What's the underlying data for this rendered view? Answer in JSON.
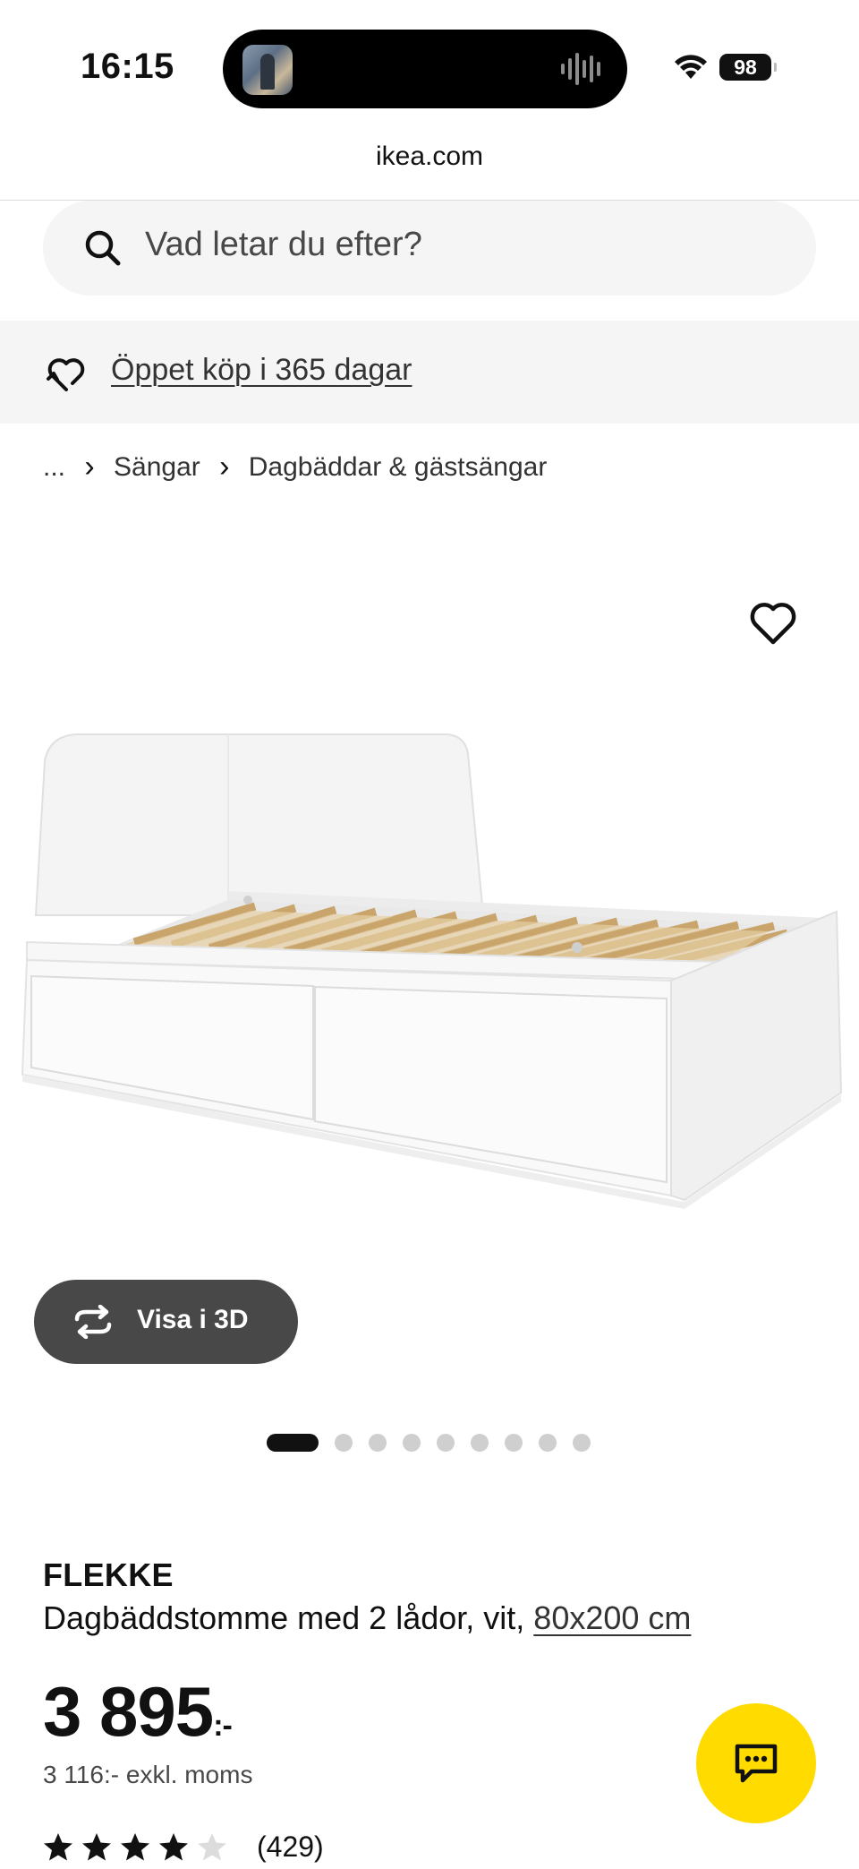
{
  "status_bar": {
    "time": "16:15",
    "battery": "98"
  },
  "browser": {
    "url": "ikea.com"
  },
  "search": {
    "placeholder": "Vad letar du efter?"
  },
  "promo": {
    "text": "Öppet köp i 365 dagar"
  },
  "breadcrumb": {
    "items": [
      "...",
      "Sängar",
      "Dagbäddar & gästsängar"
    ]
  },
  "hero": {
    "view_3d_label": "Visa i 3D",
    "carousel": {
      "total": 9,
      "active_index": 0
    }
  },
  "product": {
    "name": "FLEKKE",
    "description": "Dagbäddstomme med 2 lådor, vit,",
    "size": "80x200 cm",
    "price": "3 895",
    "price_suffix": ":-",
    "price_excl_vat": "3 116:- exkl. moms",
    "rating": {
      "stars": 4,
      "out_of": 5,
      "count": "(429)"
    }
  },
  "colors": {
    "accent_yellow": "#ffdb00",
    "dark_button": "#484848",
    "text": "#111111",
    "band": "#f5f5f5"
  },
  "icons": [
    "search-icon",
    "returns-heart-icon",
    "chevron-right-icon",
    "heart-icon",
    "rotate-3d-icon",
    "chat-icon",
    "star-icon",
    "wifi-icon"
  ]
}
